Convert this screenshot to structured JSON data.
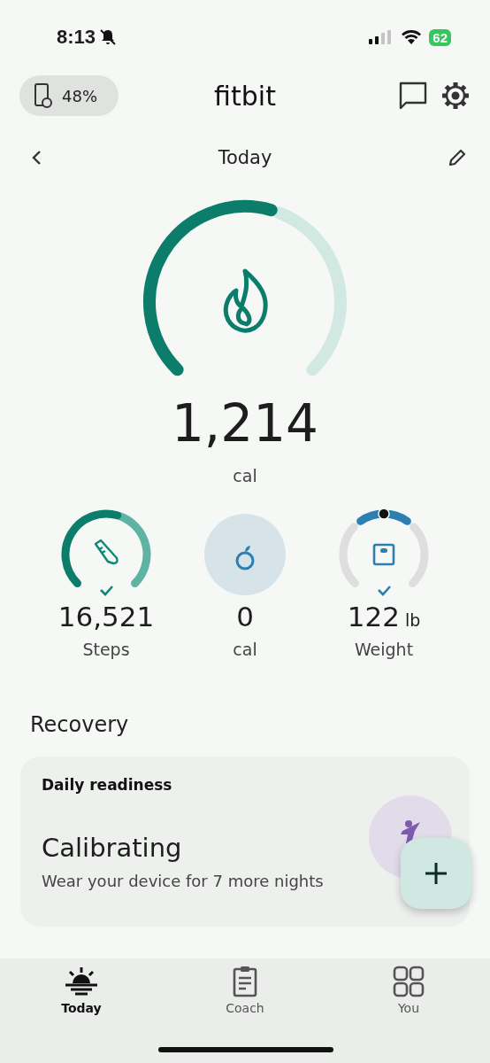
{
  "status_bar": {
    "time": "8:13",
    "silent": true,
    "battery": "62"
  },
  "header": {
    "device_battery": "48%",
    "title": "fitbit"
  },
  "day_nav": {
    "label": "Today"
  },
  "calories": {
    "value": "1,214",
    "unit": "cal"
  },
  "stats": [
    {
      "kind": "ring",
      "goal_met": true,
      "value": "16,521",
      "label": "Steps"
    },
    {
      "kind": "circle",
      "value": "0",
      "label": "cal"
    },
    {
      "kind": "range",
      "goal_met": true,
      "value": "122",
      "unit": "lb",
      "label": "Weight"
    }
  ],
  "section_title": "Recovery",
  "readiness": {
    "title": "Daily readiness",
    "status": "Calibrating",
    "message": "Wear your device for 7 more nights"
  },
  "tabs": [
    {
      "label": "Today",
      "selected": true
    },
    {
      "label": "Coach",
      "selected": false
    },
    {
      "label": "You",
      "selected": false
    }
  ]
}
